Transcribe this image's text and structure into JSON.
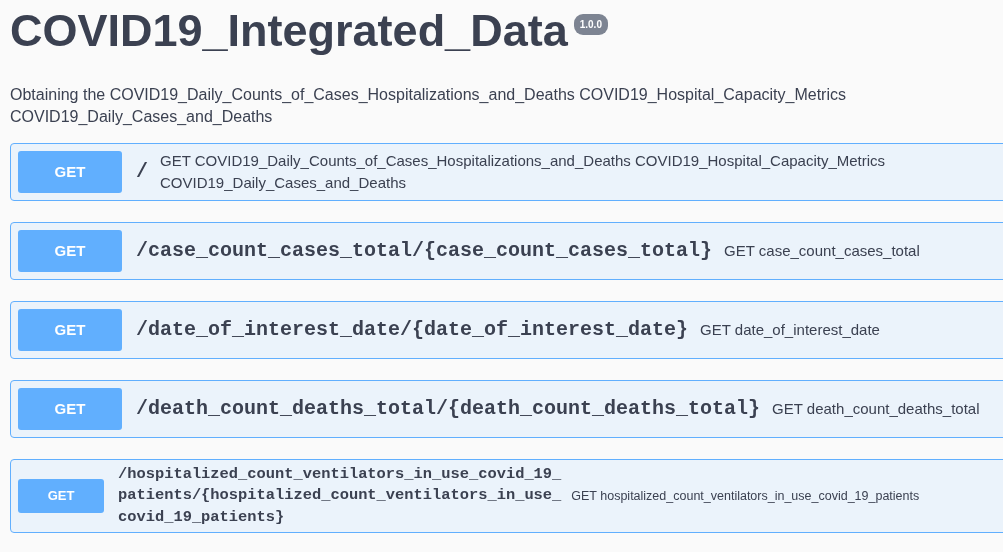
{
  "title": "COVID19_Integrated_Data",
  "version": "1.0.0",
  "description": "Obtaining the COVID19_Daily_Counts_of_Cases_Hospitalizations_and_Deaths COVID19_Hospital_Capacity_Metrics COVID19_Daily_Cases_and_Deaths",
  "operations": [
    {
      "method": "GET",
      "path": "/",
      "summary": "GET COVID19_Daily_Counts_of_Cases_Hospitalizations_and_Deaths COVID19_Hospital_Capacity_Metrics COVID19_Daily_Cases_and_Deaths"
    },
    {
      "method": "GET",
      "path": "/case_count_cases_total/{case_count_cases_total}",
      "summary": "GET case_count_cases_total"
    },
    {
      "method": "GET",
      "path": "/date_of_interest_date/{date_of_interest_date}",
      "summary": "GET date_of_interest_date"
    },
    {
      "method": "GET",
      "path": "/death_count_deaths_total/{death_count_deaths_total}",
      "summary": "GET death_count_deaths_total"
    },
    {
      "method": "GET",
      "path": "/hospitalized_count_ventilators_in_use_covid_19_patients/{hospitalized_count_ventilators_in_use_covid_19_patients}",
      "summary": "GET hospitalized_count_ventilators_in_use_covid_19_patients",
      "compact": true
    }
  ]
}
